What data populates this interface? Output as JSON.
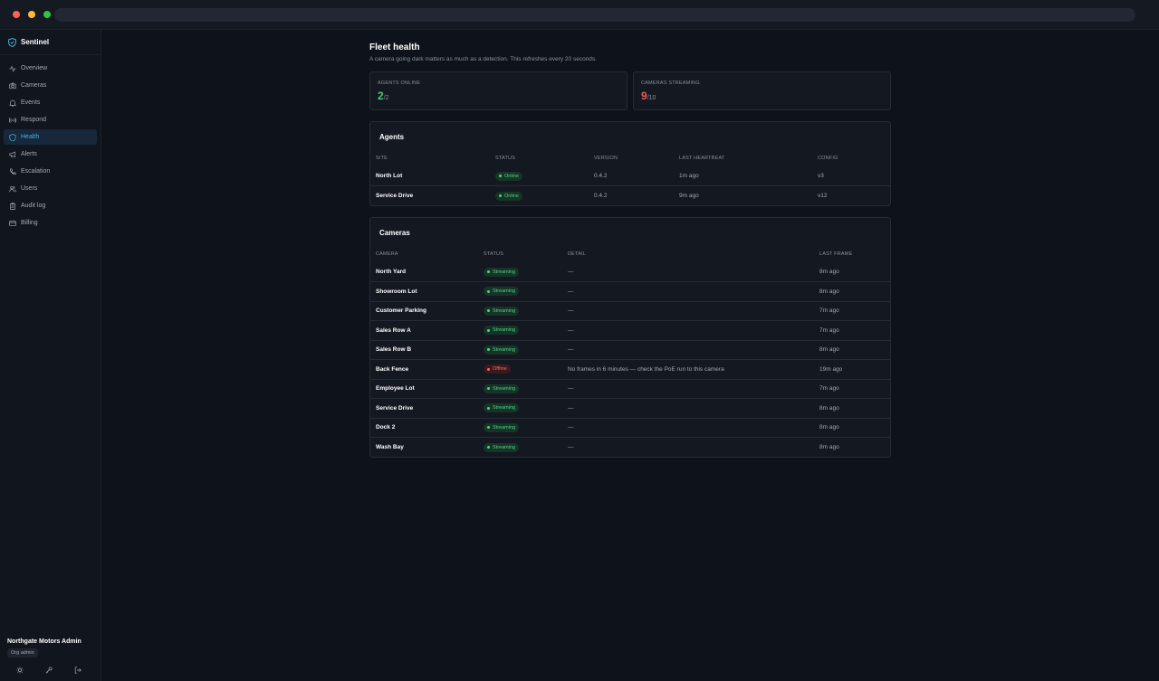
{
  "app": {
    "name": "Sentinel"
  },
  "sidebar": {
    "items": [
      {
        "label": "Overview",
        "icon": "activity-icon",
        "active": false
      },
      {
        "label": "Cameras",
        "icon": "camera-icon",
        "active": false
      },
      {
        "label": "Events",
        "icon": "bell-icon",
        "active": false
      },
      {
        "label": "Respond",
        "icon": "broadcast-icon",
        "active": false
      },
      {
        "label": "Health",
        "icon": "shield-icon",
        "active": true
      },
      {
        "label": "Alerts",
        "icon": "megaphone-icon",
        "active": false
      },
      {
        "label": "Escalation",
        "icon": "phone-icon",
        "active": false
      },
      {
        "label": "Users",
        "icon": "users-icon",
        "active": false
      },
      {
        "label": "Audit log",
        "icon": "clipboard-icon",
        "active": false
      },
      {
        "label": "Billing",
        "icon": "credit-card-icon",
        "active": false
      }
    ],
    "user": {
      "name": "Northgate Motors Admin",
      "role": "Org admin"
    }
  },
  "page": {
    "title": "Fleet health",
    "subtitle": "A camera going dark matters as much as a detection. This refreshes every 20 seconds."
  },
  "stats": {
    "agents": {
      "label": "AGENTS ONLINE",
      "value": "2",
      "total": "/2",
      "color": "#3fcf7a"
    },
    "cameras": {
      "label": "CAMERAS STREAMING",
      "value": "9",
      "total": "/10",
      "color": "#ef5b5b"
    }
  },
  "agents": {
    "title": "Agents",
    "columns": [
      "SITE",
      "STATUS",
      "VERSION",
      "LAST HEARTBEAT",
      "CONFIG"
    ],
    "rows": [
      {
        "site": "North Lot",
        "status": "Online",
        "version": "0.4.2",
        "heartbeat": "1m ago",
        "config": "v3"
      },
      {
        "site": "Service Drive",
        "status": "Online",
        "version": "0.4.2",
        "heartbeat": "9m ago",
        "config": "v12"
      }
    ]
  },
  "cameras": {
    "title": "Cameras",
    "columns": [
      "CAMERA",
      "STATUS",
      "DETAIL",
      "LAST FRAME"
    ],
    "rows": [
      {
        "camera": "North Yard",
        "status": "Streaming",
        "detail": "—",
        "last": "8m ago"
      },
      {
        "camera": "Showroom Lot",
        "status": "Streaming",
        "detail": "—",
        "last": "8m ago"
      },
      {
        "camera": "Customer Parking",
        "status": "Streaming",
        "detail": "—",
        "last": "7m ago"
      },
      {
        "camera": "Sales Row A",
        "status": "Streaming",
        "detail": "—",
        "last": "7m ago"
      },
      {
        "camera": "Sales Row B",
        "status": "Streaming",
        "detail": "—",
        "last": "8m ago"
      },
      {
        "camera": "Back Fence",
        "status": "Offline",
        "detail": "No frames in 6 minutes — check the PoE run to this camera",
        "last": "19m ago"
      },
      {
        "camera": "Employee Lot",
        "status": "Streaming",
        "detail": "—",
        "last": "7m ago"
      },
      {
        "camera": "Service Drive",
        "status": "Streaming",
        "detail": "—",
        "last": "8m ago"
      },
      {
        "camera": "Dock 2",
        "status": "Streaming",
        "detail": "—",
        "last": "8m ago"
      },
      {
        "camera": "Wash Bay",
        "status": "Streaming",
        "detail": "—",
        "last": "8m ago"
      }
    ]
  }
}
